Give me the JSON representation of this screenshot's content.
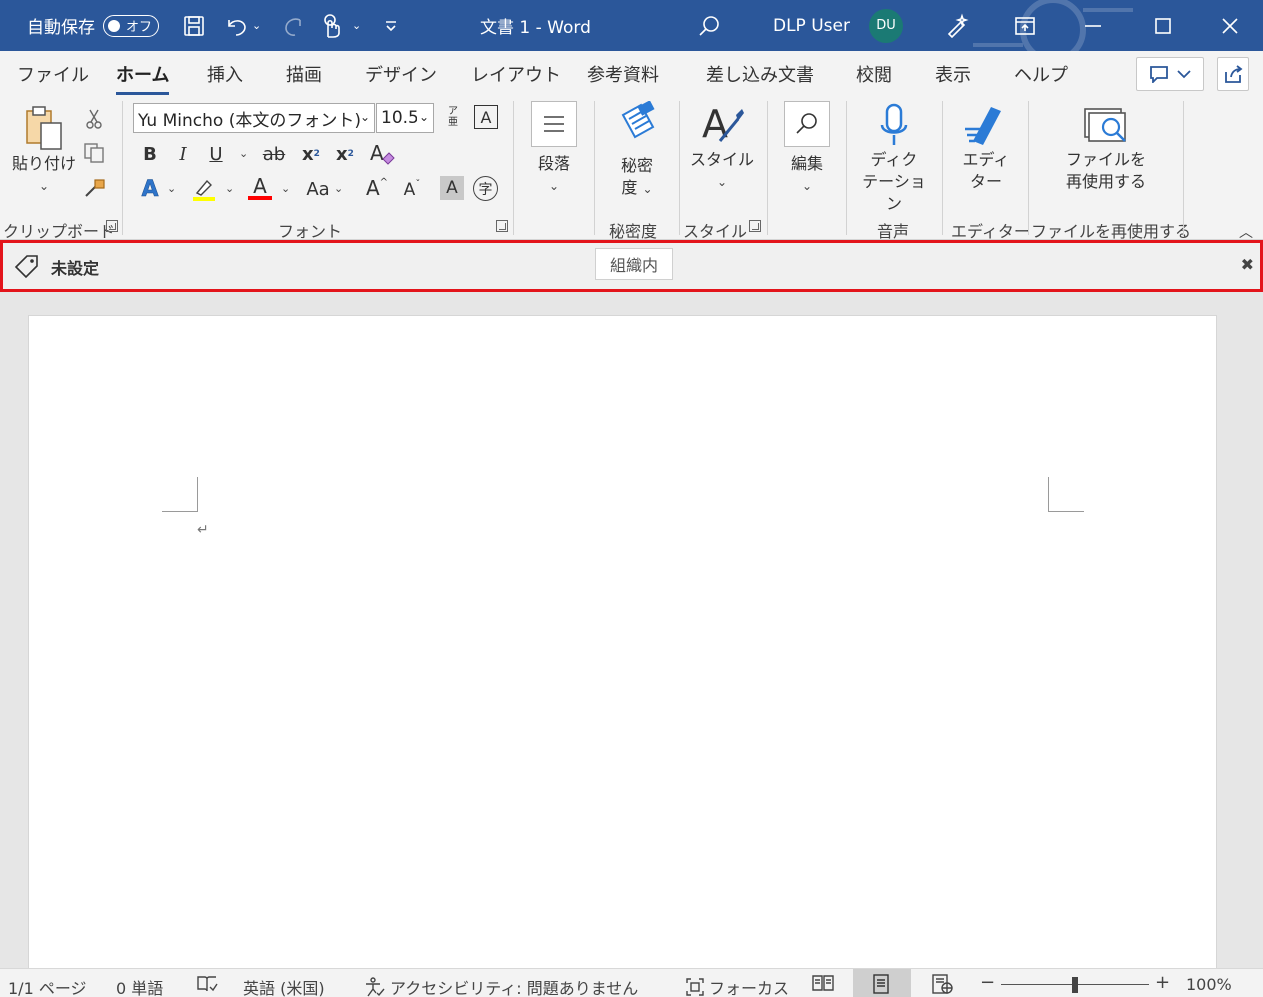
{
  "titlebar": {
    "autosave_label": "自動保存",
    "autosave_state": "オフ",
    "document_title": "文書 1  -  Word",
    "user_name": "DLP User",
    "user_initials": "DU"
  },
  "tabs": [
    "ファイル",
    "ホーム",
    "挿入",
    "描画",
    "デザイン",
    "レイアウト",
    "参考資料",
    "差し込み文書",
    "校閲",
    "表示",
    "ヘルプ"
  ],
  "active_tab": "ホーム",
  "ribbon": {
    "clipboard": {
      "paste_label": "貼り付け",
      "group_label": "クリップボード"
    },
    "font": {
      "font_name": "Yu Mincho (本文のフォント)",
      "font_size": "10.5",
      "bold": "B",
      "italic": "I",
      "underline": "U",
      "strike": "ab",
      "subscript": "x",
      "superscript": "x",
      "change_case": "Aa",
      "grow": "A",
      "shrink": "A",
      "shade": "A",
      "enclose": "字",
      "phonetic": "ア",
      "phonetic_sub": "亜",
      "text_effect": "A",
      "font_color": "A",
      "group_label": "フォント",
      "highlight_color": "#ffff00",
      "font_color_value": "#ff0000"
    },
    "paragraph": {
      "label": "段落"
    },
    "sensitivity": {
      "label_line1": "秘密",
      "label_line2": "度",
      "group_label": "秘密度"
    },
    "styles": {
      "label": "スタイル",
      "group_label": "スタイル"
    },
    "editing": {
      "label": "編集"
    },
    "voice": {
      "label_line1": "ディク",
      "label_line2": "テーション",
      "group_label": "音声"
    },
    "editor": {
      "label_line1": "エディ",
      "label_line2": "ター",
      "group_label": "エディター"
    },
    "reuse": {
      "label_line1": "ファイルを",
      "label_line2": "再使用する",
      "group_label": "ファイルを再使用する"
    }
  },
  "sensitivity_bar": {
    "status": "未設定",
    "option": "組織内",
    "border_color": "#e3141b"
  },
  "document": {
    "paragraph_mark": "↵"
  },
  "statusbar": {
    "page": "1/1 ページ",
    "words": "0 単語",
    "language": "英語 (米国)",
    "accessibility": "アクセシビリティ: 問題ありません",
    "focus": "フォーカス",
    "zoom": "100%",
    "zoom_minus": "−",
    "zoom_plus": "+"
  },
  "colors": {
    "accent": "#2b579a",
    "avatar": "#1b7a74"
  }
}
